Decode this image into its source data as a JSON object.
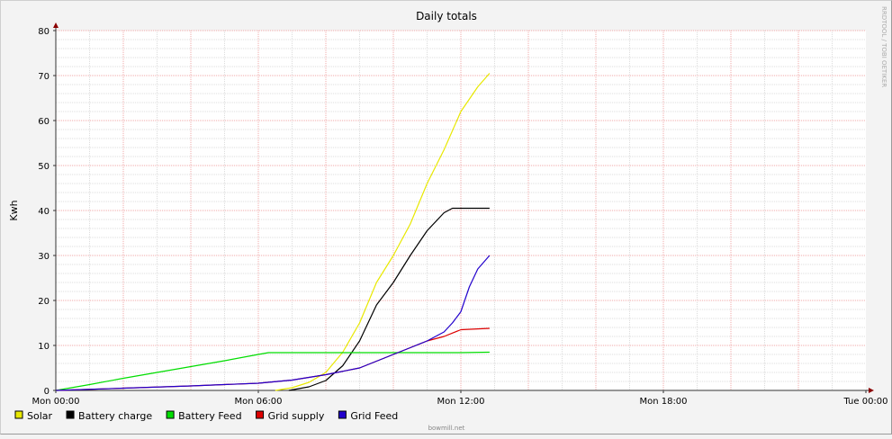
{
  "chart_data": {
    "type": "line",
    "title": "Daily totals",
    "xlabel": "",
    "ylabel": "Kwh",
    "watermark": "RRDTOOL / TOBI OETIKER",
    "footer": "bowmill.net",
    "xlim": [
      0,
      24
    ],
    "ylim": [
      0,
      80
    ],
    "x_ticks": [
      {
        "x": 0,
        "label": "Mon 00:00"
      },
      {
        "x": 6,
        "label": "Mon 06:00"
      },
      {
        "x": 12,
        "label": "Mon 12:00"
      },
      {
        "x": 18,
        "label": "Mon 18:00"
      },
      {
        "x": 24,
        "label": "Tue 00:00"
      }
    ],
    "y_ticks": [
      0,
      10,
      20,
      30,
      40,
      50,
      60,
      70,
      80
    ],
    "grid": true,
    "legend_position": "bottom",
    "series": [
      {
        "name": "Solar",
        "color": "#e8e800",
        "x": [
          6.5,
          7.0,
          7.5,
          8.0,
          8.5,
          9.0,
          9.5,
          10.0,
          10.5,
          11.0,
          11.5,
          12.0,
          12.5,
          12.85
        ],
        "y": [
          0,
          0.6,
          1.8,
          4.0,
          8.5,
          15.0,
          24.0,
          30.0,
          37.0,
          46.0,
          53.5,
          62.0,
          67.5,
          70.5
        ]
      },
      {
        "name": "Battery charge",
        "color": "#000000",
        "x": [
          6.9,
          7.5,
          8.0,
          8.5,
          9.0,
          9.5,
          10.0,
          10.5,
          11.0,
          11.5,
          11.75,
          12.0,
          12.85
        ],
        "y": [
          0,
          0.8,
          2.2,
          5.5,
          11.0,
          19.0,
          24.0,
          30.0,
          35.5,
          39.5,
          40.5,
          40.5,
          40.5
        ]
      },
      {
        "name": "Battery Feed",
        "color": "#00dd00",
        "x": [
          0,
          1,
          2,
          3,
          4,
          5,
          6,
          6.3,
          7,
          8,
          9,
          10,
          11,
          12,
          12.85
        ],
        "y": [
          0,
          1.3,
          2.7,
          4.0,
          5.3,
          6.6,
          8.0,
          8.4,
          8.4,
          8.4,
          8.4,
          8.4,
          8.4,
          8.4,
          8.5
        ]
      },
      {
        "name": "Grid supply",
        "color": "#dd0000",
        "x": [
          0,
          2,
          4,
          6,
          7,
          8,
          9,
          10,
          10.5,
          11,
          11.5,
          12,
          12.85
        ],
        "y": [
          0,
          0.5,
          1.0,
          1.6,
          2.3,
          3.5,
          5.0,
          8.0,
          9.5,
          11.0,
          12.0,
          13.5,
          13.8
        ]
      },
      {
        "name": "Grid Feed",
        "color": "#2200cc",
        "x": [
          0,
          2,
          4,
          6,
          7,
          8,
          9,
          10,
          10.5,
          11,
          11.5,
          11.75,
          12,
          12.25,
          12.5,
          12.85
        ],
        "y": [
          0,
          0.5,
          1.0,
          1.6,
          2.3,
          3.5,
          5.0,
          8.0,
          9.5,
          11.0,
          13.0,
          15.0,
          17.5,
          23.0,
          27.0,
          30.0
        ]
      }
    ]
  }
}
